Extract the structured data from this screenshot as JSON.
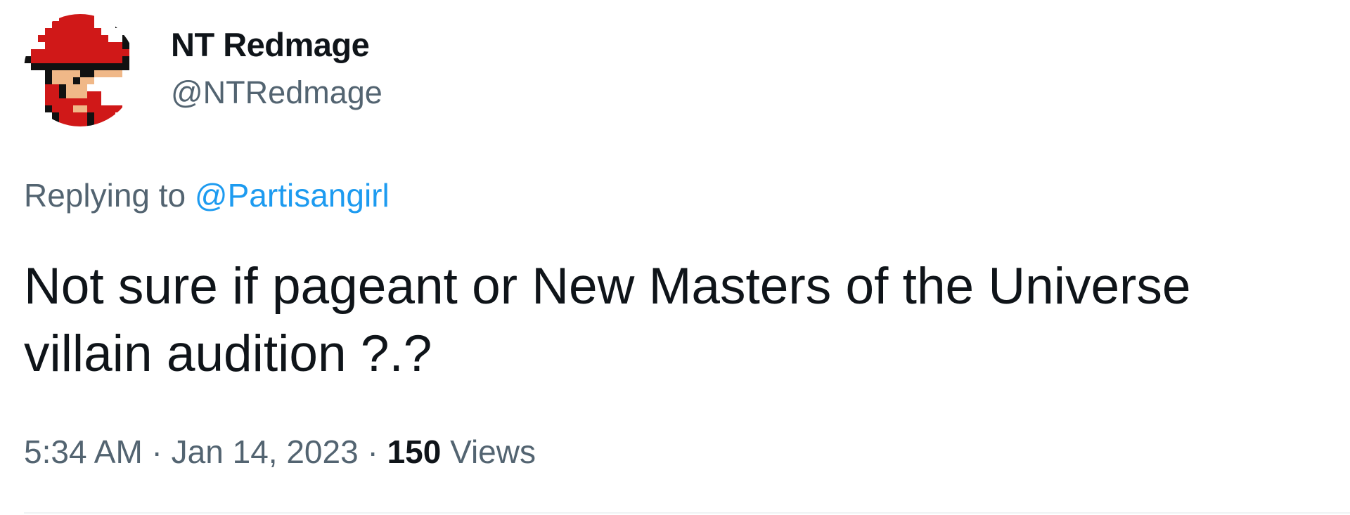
{
  "author": {
    "display_name": "NT Redmage",
    "handle": "@NTRedmage",
    "avatar_icon": "red-mage-pixel-avatar"
  },
  "reply": {
    "prefix": "Replying to ",
    "mention": "@Partisangirl"
  },
  "tweet": {
    "text": "Not sure if pageant or New Masters of the Universe villain audition ?.?"
  },
  "meta": {
    "time": "5:34 AM",
    "separator": " · ",
    "date": "Jan 14, 2023",
    "views_count": "150",
    "views_label": " Views"
  },
  "colors": {
    "text_primary": "#0f1419",
    "text_secondary": "#536471",
    "link": "#1d9bf0",
    "divider": "#eff3f4"
  }
}
